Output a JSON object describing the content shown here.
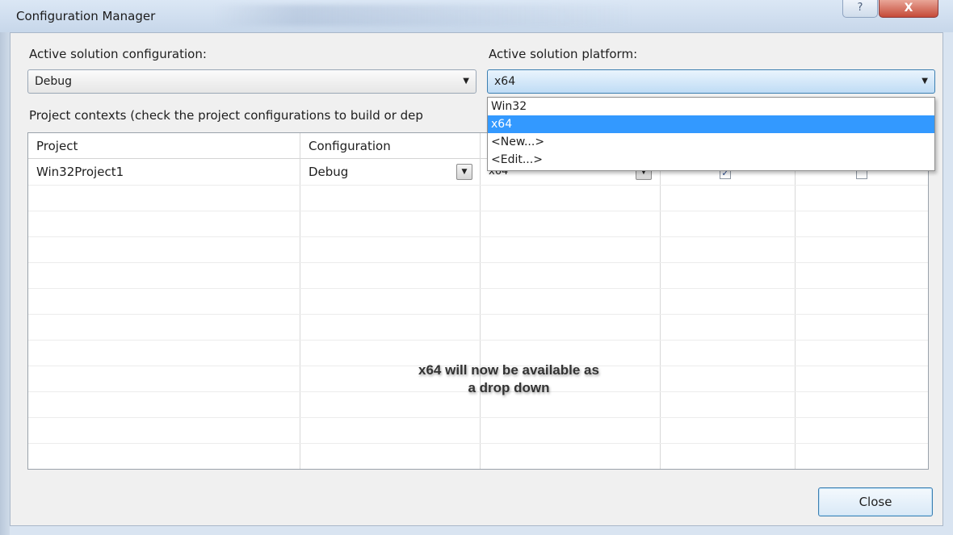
{
  "window": {
    "title": "Configuration Manager",
    "help_label": "?",
    "close_label": "X"
  },
  "active_config": {
    "label": "Active solution configuration:",
    "value": "Debug"
  },
  "active_platform": {
    "label": "Active solution platform:",
    "value": "x64",
    "options": [
      {
        "label": "Win32",
        "selected": false
      },
      {
        "label": "x64",
        "selected": true
      },
      {
        "label": "<New...>",
        "selected": false
      },
      {
        "label": "<Edit...>",
        "selected": false
      }
    ]
  },
  "project_contexts_label": "Project contexts (check the project configurations to build or dep",
  "grid": {
    "headers": [
      "Project",
      "Configuration"
    ],
    "rows": [
      {
        "project": "Win32Project1",
        "configuration": "Debug",
        "platform": "x64",
        "build": true,
        "deploy": false
      }
    ]
  },
  "annotation": {
    "line1": "x64 will now be available as",
    "line2": "a drop down"
  },
  "buttons": {
    "close": "Close"
  },
  "icons": {
    "dropdown_arrow": "chevron-down-icon",
    "checkmark": "check-icon"
  }
}
